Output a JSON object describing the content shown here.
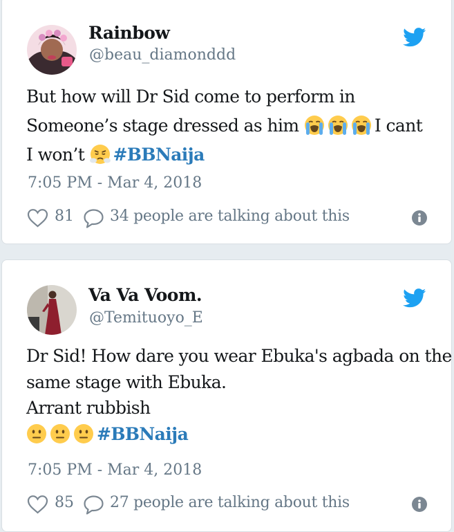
{
  "colors": {
    "background": "#e6ecf0",
    "text": "#14171a",
    "secondary": "#657786",
    "hashtag": "#2b7bb9",
    "twitter_blue": "#1da1f2"
  },
  "tweets": [
    {
      "name": "Rainbow",
      "handle": "@beau_diamonddd",
      "text_lines": [
        "But how will Dr Sid come to perform in",
        "Someone’s stage dressed as him",
        "I cant",
        "I won’t"
      ],
      "emojis": [
        "loudly-crying-face",
        "loudly-crying-face",
        "loudly-crying-face",
        "face-with-steam-from-nose"
      ],
      "hashtag": "#BBNaija",
      "timestamp": "7:05 PM - Mar 4, 2018",
      "likes": "81",
      "talking": "34 people are talking about this"
    },
    {
      "name": "Va Va Voom.",
      "handle": "@Temituoyo_E",
      "text_lines": [
        "Dr Sid! How dare you wear Ebuka's agbada on the",
        "same stage with Ebuka.",
        "Arrant rubbish"
      ],
      "emojis": [
        "neutral-face",
        "neutral-face",
        "neutral-face"
      ],
      "hashtag": "#BBNaija",
      "timestamp": "7:05 PM - Mar 4, 2018",
      "likes": "85",
      "talking": "27 people are talking about this"
    }
  ]
}
